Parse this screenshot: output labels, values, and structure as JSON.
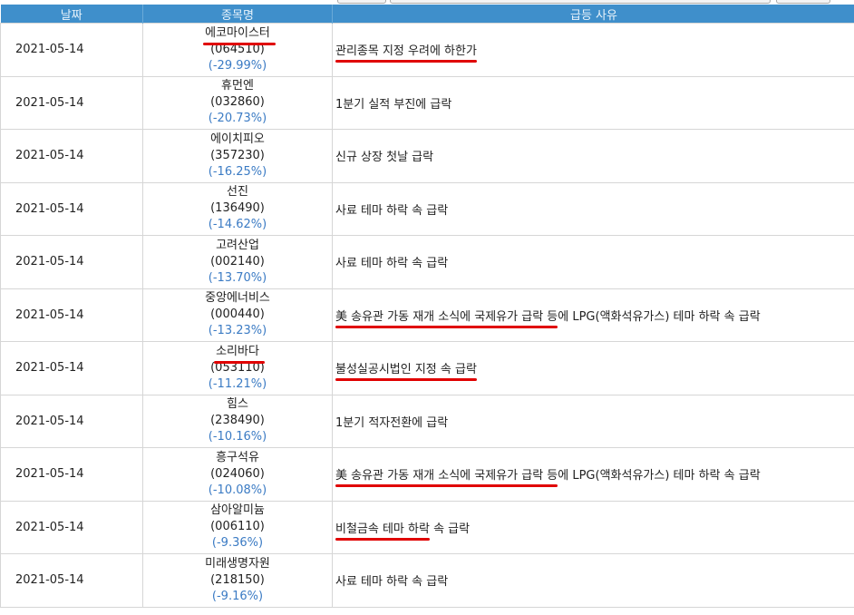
{
  "headers": {
    "date": "날짜",
    "stock": "종목명",
    "reason": "급등 사유"
  },
  "rows": [
    {
      "date": "2021-05-14",
      "name": "에코마이스터",
      "code": "(064510)",
      "pct": "(-29.99%)",
      "reason_pre": "",
      "reason_ul": "관리종목 지정 우려에 하한가",
      "reason_post": "",
      "name_ul": true
    },
    {
      "date": "2021-05-14",
      "name": "휴먼엔",
      "code": "(032860)",
      "pct": "(-20.73%)",
      "reason_pre": "1분기 실적 부진에 급락",
      "reason_ul": "",
      "reason_post": "",
      "name_ul": false
    },
    {
      "date": "2021-05-14",
      "name": "에이치피오",
      "code": "(357230)",
      "pct": "(-16.25%)",
      "reason_pre": "신규 상장 첫날 급락",
      "reason_ul": "",
      "reason_post": "",
      "name_ul": false
    },
    {
      "date": "2021-05-14",
      "name": "선진",
      "code": "(136490)",
      "pct": "(-14.62%)",
      "reason_pre": "사료 테마 하락 속 급락",
      "reason_ul": "",
      "reason_post": "",
      "name_ul": false
    },
    {
      "date": "2021-05-14",
      "name": "고려산업",
      "code": "(002140)",
      "pct": "(-13.70%)",
      "reason_pre": "사료 테마 하락 속 급락",
      "reason_ul": "",
      "reason_post": "",
      "name_ul": false
    },
    {
      "date": "2021-05-14",
      "name": "중앙에너비스",
      "code": "(000440)",
      "pct": "(-13.23%)",
      "reason_pre": "",
      "reason_ul": "美 송유관 가동 재개 소식에 국제유가 급락 등",
      "reason_post": "에 LPG(액화석유가스) 테마 하락 속 급락",
      "name_ul": false
    },
    {
      "date": "2021-05-14",
      "name": "소리바다",
      "code": "(053110)",
      "pct": "(-11.21%)",
      "reason_pre": "",
      "reason_ul": "불성실공시법인 지정 속 급락",
      "reason_post": "",
      "name_ul": true
    },
    {
      "date": "2021-05-14",
      "name": "힘스",
      "code": "(238490)",
      "pct": "(-10.16%)",
      "reason_pre": "1분기 적자전환에 급락",
      "reason_ul": "",
      "reason_post": "",
      "name_ul": false
    },
    {
      "date": "2021-05-14",
      "name": "흥구석유",
      "code": "(024060)",
      "pct": "(-10.08%)",
      "reason_pre": "",
      "reason_ul": "美 송유관 가동 재개 소식에 국제유가 급락 등",
      "reason_post": "에 LPG(액화석유가스) 테마 하락 속 급락",
      "name_ul": false
    },
    {
      "date": "2021-05-14",
      "name": "삼아알미늄",
      "code": "(006110)",
      "pct": "(-9.36%)",
      "reason_pre": "",
      "reason_ul": "비철금속 테마 하락",
      "reason_post": " 속 급락",
      "name_ul": false
    },
    {
      "date": "2021-05-14",
      "name": "미래생명자원",
      "code": "(218150)",
      "pct": "(-9.16%)",
      "reason_pre": "사료 테마 하락 속 급락",
      "reason_ul": "",
      "reason_post": "",
      "name_ul": false
    }
  ],
  "colors": {
    "header_bg": "#3f8fcb",
    "pct_text": "#3b7bc4",
    "annotation_underline": "#e00000"
  }
}
